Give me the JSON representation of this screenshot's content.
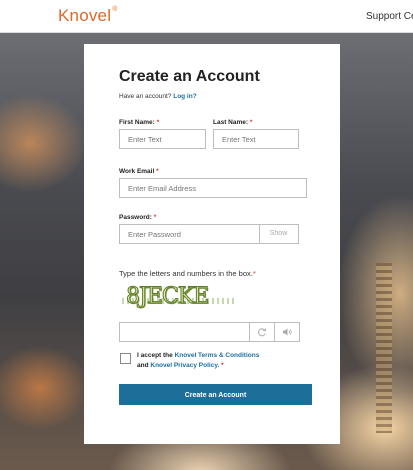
{
  "header": {
    "logo": "Knovel",
    "logo_mark": "®",
    "support_link": "Support Ce"
  },
  "form": {
    "title": "Create an Account",
    "have_account_text": "Have an account?",
    "login_link": "Log in?",
    "first_name": {
      "label": "First Name:",
      "required": "*",
      "placeholder": "Enter Text"
    },
    "last_name": {
      "label": "Last Name:",
      "required": "*",
      "placeholder": "Enter Text"
    },
    "work_email": {
      "label": "Work Email",
      "required": "*",
      "placeholder": "Enter Email Address"
    },
    "password": {
      "label": "Password:",
      "required": "*",
      "placeholder": "Enter Password",
      "show_label": "Show"
    },
    "captcha": {
      "instruction": "Type the letters and numbers in the box.",
      "required": "*",
      "image_text": "8JECKE",
      "value": ""
    },
    "terms": {
      "line1_prefix": "I accept the",
      "terms_link": "Knovel Terms & Conditions",
      "line2_prefix": "and",
      "privacy_link": "Knovel Privacy Policy.",
      "required": "*",
      "checked": false
    },
    "submit_label": "Create an Account"
  },
  "colors": {
    "brand_orange": "#e0682b",
    "link_blue": "#1a6fa3",
    "button_blue": "#1d6f9a",
    "required_red": "#e0342b"
  },
  "icons": {
    "refresh": "refresh-icon",
    "audio": "speaker-icon"
  }
}
